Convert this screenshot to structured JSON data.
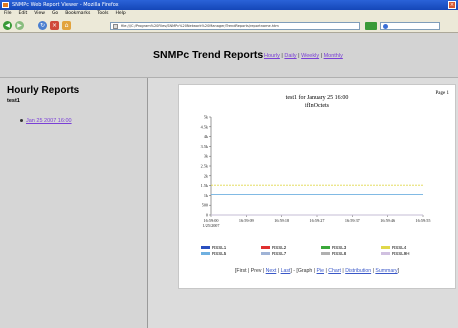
{
  "browser": {
    "title": "SNMPc Web Report Viewer - Mozilla Firefox",
    "menu": [
      "File",
      "Edit",
      "View",
      "Go",
      "Bookmarks",
      "Tools",
      "Help"
    ],
    "address": "file:///C:/Program%20Files/SNMPc%20Network%20Manager/TrendReports/reportname.htm"
  },
  "header": {
    "title": "SNMPc Trend Reports",
    "periods": [
      {
        "label": "Hourly"
      },
      {
        "label": "Daily"
      },
      {
        "label": "Weekly"
      },
      {
        "label": "Monthly"
      }
    ]
  },
  "sidebar": {
    "title": "Hourly Reports",
    "subtitle": "test1",
    "items": [
      {
        "label": "Jan 25 2007 16:00"
      }
    ]
  },
  "report": {
    "title_line1": "test1 for January 25 16:00",
    "title_line2": "ifInOctets",
    "page_label": "Page 1",
    "nav": {
      "first": "First",
      "prev": "Prev",
      "next": "Next",
      "last": "Last",
      "graph": "Graph",
      "pie": "Pie",
      "chart": "Chart",
      "distribution": "Distribution",
      "summary": "Summary"
    }
  },
  "chart_data": {
    "type": "line",
    "x": [
      "16:59:00\n1/25/2007",
      "16:59:09",
      "16:59:18",
      "16:59:27",
      "16:59:37",
      "16:59:46",
      "16:59:55"
    ],
    "ylim": [
      0,
      5000
    ],
    "yticks": [
      "0",
      "500",
      "1k",
      "1.5k",
      "2k",
      "2.5k",
      "3k",
      "3.5k",
      "4k",
      "4.5k",
      "5k"
    ],
    "series": [
      {
        "name": "RSSL1",
        "color": "#2a4fbf",
        "values": [
          0,
          0,
          0,
          0,
          0,
          0,
          0
        ]
      },
      {
        "name": "RSSL2",
        "color": "#e03030",
        "values": [
          0,
          0,
          0,
          0,
          0,
          0,
          0
        ]
      },
      {
        "name": "RSSL3",
        "color": "#3aa83a",
        "values": [
          0,
          0,
          0,
          0,
          0,
          0,
          0
        ]
      },
      {
        "name": "RSSL4",
        "color": "#e0d84a",
        "values": [
          1520,
          1520,
          1520,
          1520,
          1520,
          1520,
          1520
        ]
      },
      {
        "name": "RSSL5",
        "color": "#6fb0e0",
        "values": [
          1050,
          1050,
          1050,
          1050,
          1050,
          1050,
          1050
        ]
      },
      {
        "name": "RSSL7",
        "color": "#9fb3d6",
        "values": [
          0,
          0,
          0,
          0,
          0,
          0,
          0
        ]
      },
      {
        "name": "RSSL8",
        "color": "#b0b0b0",
        "values": [
          0,
          0,
          0,
          0,
          0,
          0,
          0
        ]
      },
      {
        "name": "RSSL9H",
        "color": "#d0c0e0",
        "values": [
          0,
          0,
          0,
          0,
          0,
          0,
          0
        ]
      }
    ]
  }
}
